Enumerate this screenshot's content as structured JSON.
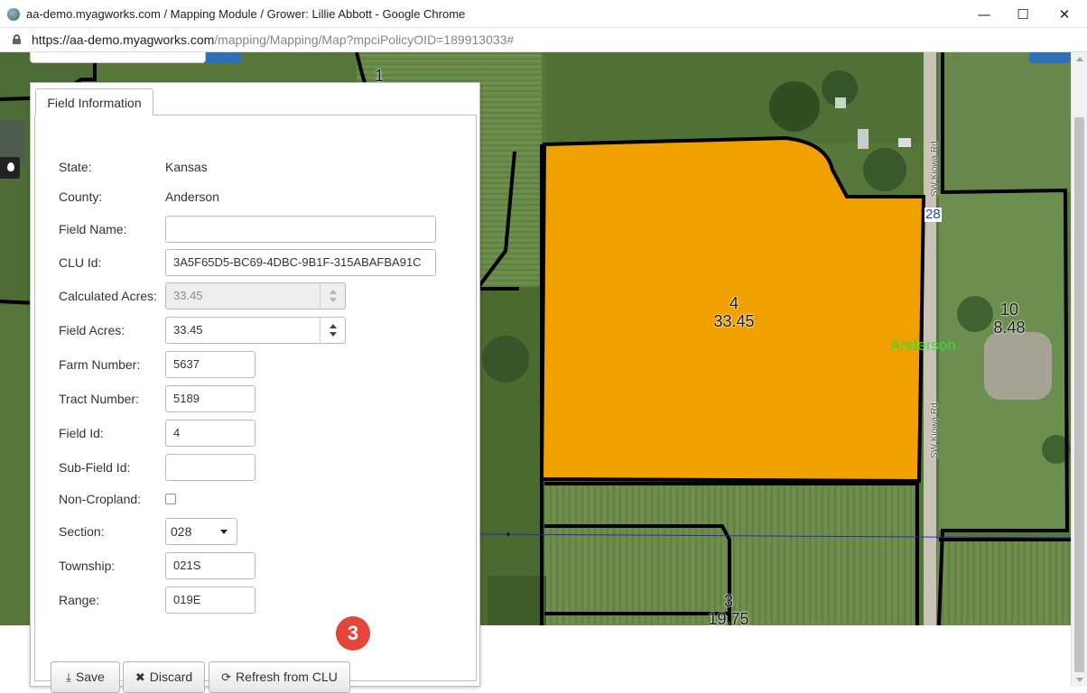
{
  "window": {
    "title": "aa-demo.myagworks.com / Mapping Module / Grower: Lillie Abbott - Google Chrome",
    "controls": {
      "minimize": "—",
      "maximize": "☐",
      "close": "✕"
    }
  },
  "address_bar": {
    "url_host": "https://aa-demo.myagworks.com",
    "url_path": "/mapping/Mapping/Map?mpciPolicyOID=189913033#"
  },
  "map": {
    "fields": [
      {
        "number": "4",
        "acres": "33.45"
      },
      {
        "number": "10",
        "acres": "8.48"
      },
      {
        "number": "3",
        "acres": "19.75"
      },
      {
        "number": "1",
        "acres": ""
      }
    ],
    "road_label": "SW Kiowa Rd",
    "road_shield": "28",
    "county_label": "Anderson",
    "colors": {
      "selected_field": "#f0a000",
      "boundary": "#000000"
    }
  },
  "panel": {
    "tab_label": "Field Information",
    "state": {
      "label": "State:",
      "value": "Kansas"
    },
    "county": {
      "label": "County:",
      "value": "Anderson"
    },
    "field_name": {
      "label": "Field Name:",
      "value": ""
    },
    "clu_id": {
      "label": "CLU Id:",
      "value": "3A5F65D5-BC69-4DBC-9B1F-315ABAFBA91C"
    },
    "calculated_acres": {
      "label": "Calculated Acres:",
      "value": "33.45"
    },
    "field_acres": {
      "label": "Field Acres:",
      "value": "33.45"
    },
    "farm_number": {
      "label": "Farm Number:",
      "value": "5637"
    },
    "tract_number": {
      "label": "Tract Number:",
      "value": "5189"
    },
    "field_id": {
      "label": "Field Id:",
      "value": "4"
    },
    "sub_field_id": {
      "label": "Sub-Field Id:",
      "value": ""
    },
    "non_cropland": {
      "label": "Non-Cropland:",
      "checked": false
    },
    "section": {
      "label": "Section:",
      "value": "028"
    },
    "township": {
      "label": "Township:",
      "value": "021S"
    },
    "range": {
      "label": "Range:",
      "value": "019E"
    },
    "buttons": {
      "save": "Save",
      "discard": "Discard",
      "refresh": "Refresh from CLU"
    }
  },
  "step_badge": "3"
}
